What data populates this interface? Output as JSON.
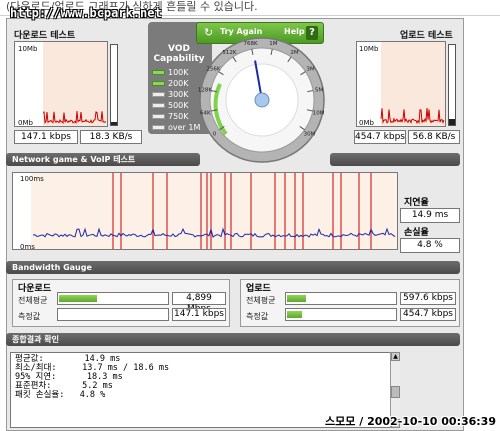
{
  "caption": "(다운로드/업로드 그래프가 심하게 흔들릴 수 있습니다.",
  "watermark": "http://www.bcpark.net",
  "download": {
    "title": "다운로드 테스트",
    "ymax": "10Mb",
    "ymin": "0Mb",
    "kbps": "147.1 kbps",
    "kbs": "18.3 KB/s"
  },
  "upload": {
    "title": "업로드 테스트",
    "ymax": "10Mb",
    "ymin": "0Mb",
    "kbps": "454.7 kbps",
    "kbs": "56.8 KB/s"
  },
  "vod": {
    "title_line1": "VOD",
    "title_line2": "Capability",
    "items": [
      {
        "label": "100K",
        "on": true
      },
      {
        "label": "200K",
        "on": true
      },
      {
        "label": "300K",
        "on": false
      },
      {
        "label": "500K",
        "on": false
      },
      {
        "label": "750K",
        "on": false
      },
      {
        "label": "over 1M",
        "on": false
      }
    ]
  },
  "buttons": {
    "try_again": "Try Again",
    "help": "Help",
    "help_q": "?"
  },
  "gauge": {
    "labels": [
      "0",
      "64K",
      "128K",
      "256K",
      "512K",
      "768K",
      "1M",
      "2M",
      "3M",
      "5M",
      "10M",
      "30M"
    ],
    "needle_fraction": 0.46
  },
  "network": {
    "section_title": "Network game & VoIP 테스트",
    "ymax": "100ms",
    "ymin": "0ms",
    "latency_label": "지연율",
    "latency_value": "14.9 ms",
    "loss_label": "손실율",
    "loss_value": "4.8 %"
  },
  "bandwidth": {
    "section_title": "Bandwidth Gauge",
    "download": {
      "title": "다운로드",
      "avg_label": "전체평균",
      "avg_value": "4,899 Mbps",
      "avg_fill": 0.35,
      "meas_label": "측정값",
      "meas_value": "147.1 kbps",
      "meas_fill": 0.0
    },
    "upload": {
      "title": "업로드",
      "avg_label": "전체평균",
      "avg_value": "597.6 kbps",
      "avg_fill": 0.18,
      "meas_label": "측정값",
      "meas_value": "454.7 kbps",
      "meas_fill": 0.14
    }
  },
  "results": {
    "section_title": "종합결과 확인",
    "lines": [
      "평균값:        14.9 ms",
      "최소/최대:     13.7 ms / 18.6 ms",
      "95% 지연:      18.3 ms",
      "표준편차:      5.2 ms",
      "패킷 손실율:   4.8 %"
    ]
  },
  "stamp": "스모모 / 2002-10-10 00:36:39",
  "colors": {
    "accent_green": "#5fa82c",
    "loss_red": "#cc0000",
    "latency_blue": "#1a2aa8"
  }
}
